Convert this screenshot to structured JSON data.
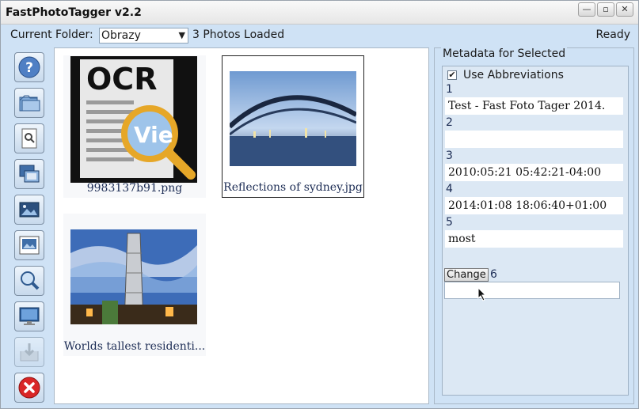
{
  "window": {
    "title": "FastPhotoTagger v2.2",
    "controls": [
      "minimize-icon",
      "maximize-icon",
      "close-icon"
    ]
  },
  "topbar": {
    "folder_label": "Current Folder:",
    "folder_value": "Obrazy",
    "photos_loaded": "3 Photos Loaded",
    "status": "Ready"
  },
  "toolbar": {
    "icons": [
      "help-icon",
      "open-folder-icon",
      "document-search-icon",
      "slideshow-icon",
      "image-icon",
      "image-edit-icon",
      "search-icon",
      "monitor-icon",
      "export-icon",
      "exit-icon"
    ]
  },
  "gallery": {
    "items": [
      {
        "caption": "9983137b91.png",
        "selected": false
      },
      {
        "caption": "Reflections of sydney.jpg",
        "selected": true
      },
      {
        "caption": "Worlds tallest residenti...",
        "selected": false
      }
    ]
  },
  "metadata": {
    "title": "Metadata for Selected",
    "use_abbreviations_label": "Use Abbreviations",
    "use_abbreviations_checked": true,
    "fields": [
      {
        "num": "1",
        "value": "Test - Fast Foto Tager 2014."
      },
      {
        "num": "2",
        "value": ""
      },
      {
        "num": "3",
        "value": "2010:05:21 05:42:21-04:00"
      },
      {
        "num": "4",
        "value": "2014:01:08 18:06:40+01:00"
      },
      {
        "num": "5",
        "value": "most"
      }
    ],
    "change_label": "Change",
    "field6_num": "6",
    "field6_value": ""
  },
  "colors": {
    "accent": "#cfe2f5",
    "panel_inner": "#dce8f4",
    "caption_text": "#1d2d55",
    "exit_red": "#d92626"
  }
}
